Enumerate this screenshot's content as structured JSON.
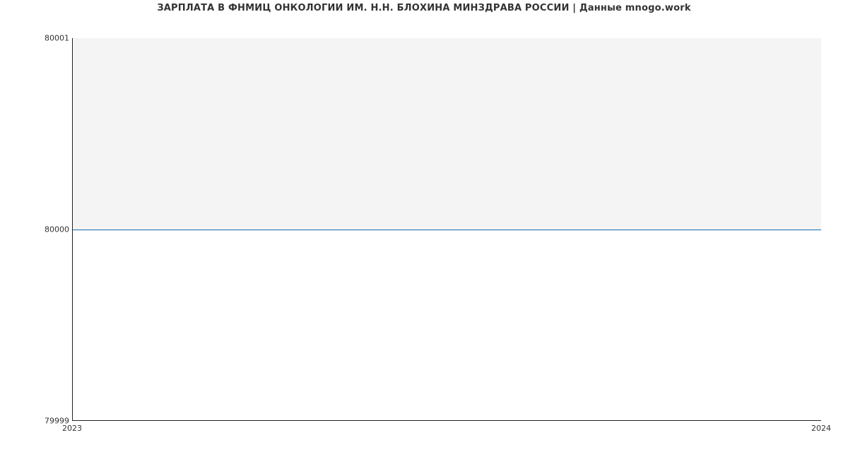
{
  "chart_data": {
    "type": "line",
    "title": "ЗАРПЛАТА В ФНМИЦ ОНКОЛОГИИ ИМ. Н.Н. БЛОХИНА МИНЗДРАВА РОССИИ | Данные mnogo.work",
    "xlabel": "",
    "ylabel": "",
    "x": [
      "2023",
      "2024"
    ],
    "y": [
      80000,
      80000
    ],
    "xlim": [
      "2023",
      "2024"
    ],
    "ylim": [
      79999,
      80001
    ],
    "yticks": [
      79999,
      80000,
      80001
    ],
    "xticks": [
      "2023",
      "2024"
    ]
  },
  "yticks_labels": {
    "t0": "79999",
    "t1": "80000",
    "t2": "80001"
  },
  "xticks_labels": {
    "t0": "2023",
    "t1": "2024"
  }
}
